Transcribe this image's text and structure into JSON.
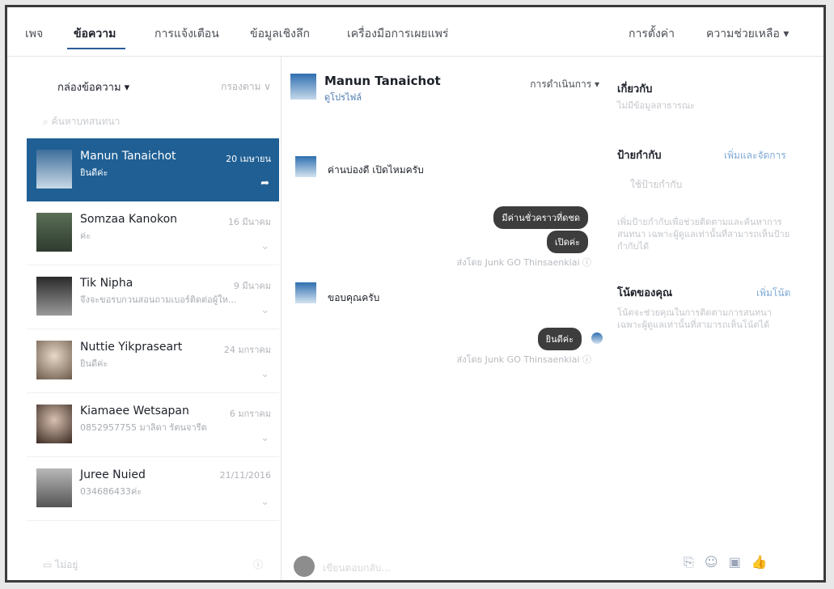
{
  "nav": {
    "items": [
      "เพจ",
      "ข้อความ",
      "การแจ้งเตือน",
      "ข้อมูลเชิงลึก",
      "เครื่องมือการเผยแพร่"
    ],
    "settings": "การตั้งค่า",
    "help": "ความช่วยเหลือ ▾"
  },
  "inbox": {
    "title": "กล่องข้อความ ▾",
    "filter": "กรองตาม ∨",
    "search_placeholder": "ค้นหาบทสนทนา",
    "footer": "ไม่อยู่",
    "conversations": [
      {
        "name": "Manun Tanaichot",
        "snippet": "ยินดีค่ะ",
        "date": "20 เมษายน"
      },
      {
        "name": "Somzaa Kanokon",
        "snippet": "ค่ะ",
        "date": "16 มีนาคม"
      },
      {
        "name": "Tik Nipha",
        "snippet": "จึงจะขอรบกวนสอนถามเบอร์ติดต่อผู้ให...",
        "date": "9 มีนาคม"
      },
      {
        "name": "Nuttie Yikpraseart",
        "snippet": "ยินดีค่ะ",
        "date": "24 มกราคม"
      },
      {
        "name": "Kiamaee Wetsapan",
        "snippet": "0852957755 มาลิดา รัตนจารีต",
        "date": "6 มกราคม"
      },
      {
        "name": "Juree Nuied",
        "snippet": "034686433ค่ะ",
        "date": "21/11/2016"
      }
    ]
  },
  "chat": {
    "name": "Manun Tanaichot",
    "profile_link": "ดูโปรไฟล์",
    "actions": "การดำเนินการ ▾",
    "msg1": "ค่านบ่องดี เปิดไหมครับ",
    "reply1": "มีค่านชั่วคราวที่ดชด",
    "reply2": "เปิดค่ะ",
    "sent_by1": "ส่งโดย Junk GO Thinsaenkiai ⓘ",
    "msg2": "ขอบคุณครับ",
    "reply3": "ยินดีค่ะ",
    "sent_by2": "ส่งโดย Junk GO Thinsaenkiai ⓘ",
    "composer_placeholder": "เขียนตอบกลับ..."
  },
  "about": {
    "title": "เกี่ยวกับ",
    "text": "ไม่มีข้อมูลสาธารณะ"
  },
  "tags": {
    "title": "ป้ายกำกับ",
    "link": "เพิ่มและจัดการ",
    "placeholder": "ใช้ป้ายกำกับ",
    "help": "เพิ่มป้ายกำกับเพื่อช่วยติดตามและค้นหาการสนทนา เฉพาะผู้ดูแลเท่านั้นที่สามารถเห็นป้ายกำกับได้"
  },
  "notes": {
    "title": "โน้ตของคุณ",
    "link": "เพิ่มโน้ต",
    "help": "โน้ตจะช่วยคุณในการติดตามการสนทนา เฉพาะผู้ดูแลเท่านั้นที่สามารถเห็นโน้ตได้"
  },
  "icons": [
    "paperclip-icon",
    "emoji-icon",
    "sticker-icon",
    "thumbs-up-icon"
  ]
}
